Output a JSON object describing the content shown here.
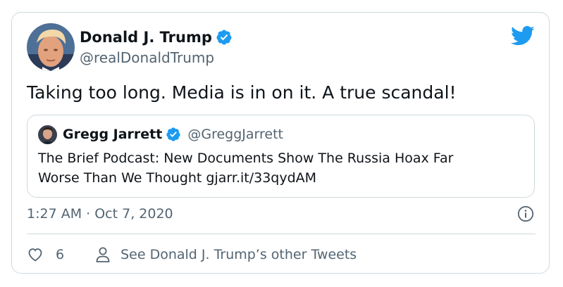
{
  "tweet": {
    "author": {
      "name": "Donald J. Trump",
      "handle": "@realDonaldTrump",
      "verified": true
    },
    "text": "Taking too long. Media is in on it. A true scandal!",
    "quoted": {
      "author_name": "Gregg Jarrett",
      "author_handle": "@GreggJarrett",
      "verified": true,
      "text": "The Brief Podcast: New Documents Show The Russia Hoax Far\nWorse Than We Thought gjarr.it/33qydAM"
    },
    "timestamp": "1:27 AM · Oct 7, 2020",
    "like_count": "6",
    "see_more_label": "See Donald J. Trump’s other Tweets"
  },
  "icons": {
    "brand": "twitter-bird-icon",
    "verified": "verified-badge-icon",
    "info": "info-icon",
    "like": "heart-icon",
    "profile": "person-icon"
  },
  "colors": {
    "twitter_blue": "#1d9bf0",
    "text_primary": "#0f1419",
    "text_secondary": "#536471",
    "border": "#cfd9de"
  }
}
